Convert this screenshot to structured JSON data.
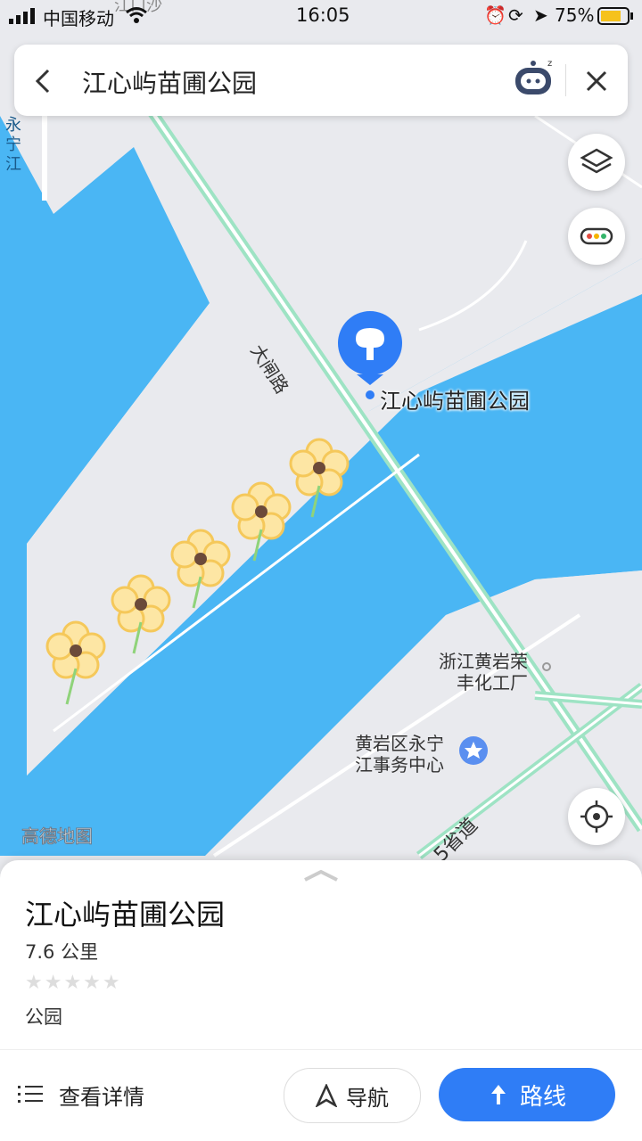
{
  "status_bar": {
    "carrier": "中国移动",
    "time": "16:05",
    "battery": "75%"
  },
  "search": {
    "query": "江心屿苗圃公园"
  },
  "map": {
    "poi_label": "江心屿苗圃公园",
    "road_daozha": "大闸路",
    "road_provincial": "5省道",
    "place_rongfeng": [
      "浙江黄岩荣",
      "丰化工厂"
    ],
    "place_yongning": [
      "黄岩区永宁",
      "江事务中心"
    ],
    "river_label": "永宁江",
    "top_label": "江口沙",
    "watermark": "高德地图",
    "water_color": "#4ab6f4",
    "land_color": "#e9eaee"
  },
  "sheet": {
    "title": "江心屿苗圃公园",
    "distance": "7.6 公里",
    "rating_stars": 0,
    "category": "公园",
    "details_label": "查看详情",
    "nav_label": "导航",
    "route_label": "路线"
  }
}
